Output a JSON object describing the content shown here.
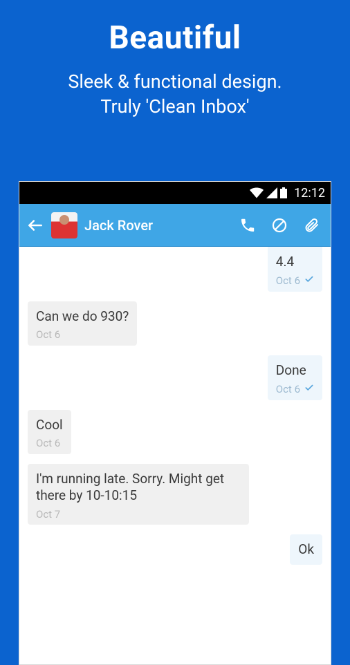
{
  "hero": {
    "title": "Beautiful",
    "subtitle_line1": "Sleek & functional design.",
    "subtitle_line2": "Truly 'Clean Inbox'"
  },
  "statusbar": {
    "time": "12:12"
  },
  "header": {
    "contact_name": "Jack Rover"
  },
  "messages": [
    {
      "direction": "sent",
      "text": "4.4",
      "date": "Oct 6",
      "delivered": true
    },
    {
      "direction": "received",
      "text": "Can we do 930?",
      "date": "Oct 6",
      "delivered": false
    },
    {
      "direction": "sent",
      "text": "Done",
      "date": "Oct 6",
      "delivered": true
    },
    {
      "direction": "received",
      "text": "Cool",
      "date": "Oct 6",
      "delivered": false
    },
    {
      "direction": "received",
      "text": "I'm running late. Sorry. Might get there by 10-10:15",
      "date": "Oct 7",
      "delivered": false
    },
    {
      "direction": "sent",
      "text": "Ok",
      "date": "",
      "delivered": false
    }
  ]
}
